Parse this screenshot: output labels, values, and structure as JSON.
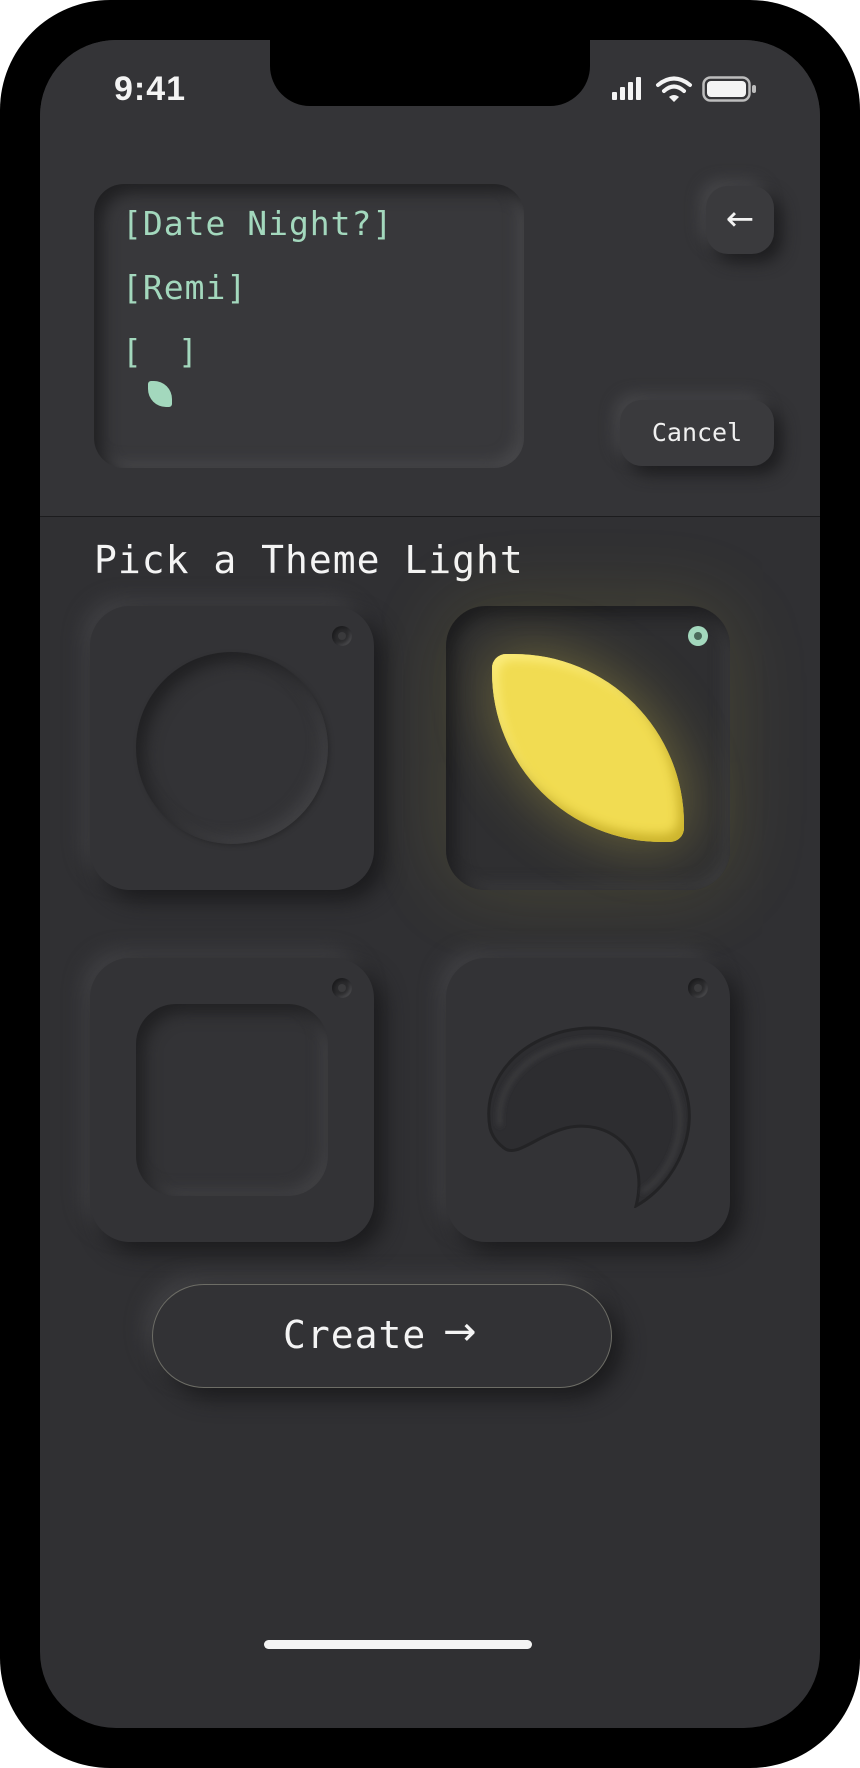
{
  "status_bar": {
    "time": "9:41",
    "icons": [
      "cellular-signal-icon",
      "wifi-icon",
      "battery-icon"
    ]
  },
  "preview": {
    "title": "[Date Night?]",
    "name": "[Remi]",
    "icon_open": "[",
    "icon_close": "]",
    "icon": "leaf-icon"
  },
  "header": {
    "back_icon": "←",
    "cancel_label": "Cancel"
  },
  "theme_picker": {
    "title": "Pick a Theme Light",
    "options": [
      {
        "shape": "circle",
        "selected": false,
        "color": "#333336"
      },
      {
        "shape": "leaf",
        "selected": true,
        "color": "#f1dc52"
      },
      {
        "shape": "rounded-square",
        "selected": false,
        "color": "#333336"
      },
      {
        "shape": "crescent",
        "selected": false,
        "color": "#333336"
      }
    ]
  },
  "actions": {
    "create_label": "Create",
    "create_arrow": "→"
  },
  "colors": {
    "accent": "#a3d8bd",
    "highlight": "#f1dc52",
    "background": "#303033"
  }
}
